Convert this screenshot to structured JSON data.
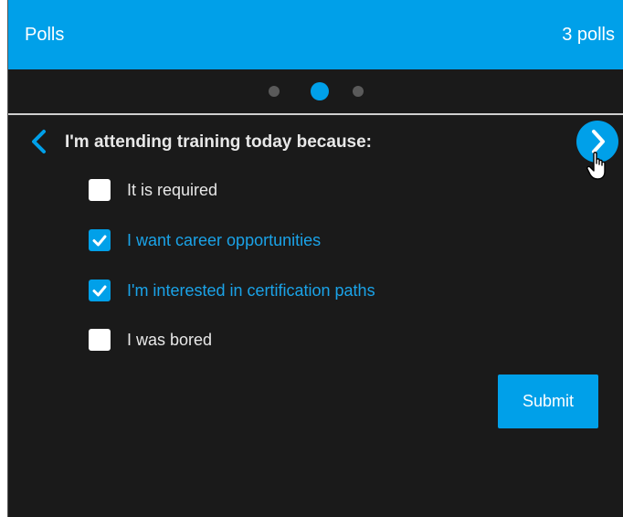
{
  "header": {
    "title": "Polls",
    "count": "3 polls"
  },
  "pager": {
    "total": 3,
    "active_index": 2
  },
  "poll": {
    "question": "I'm attending training today because:",
    "options": [
      {
        "label": "It is required",
        "checked": false
      },
      {
        "label": "I want career opportunities",
        "checked": true
      },
      {
        "label": "I'm interested in certification paths",
        "checked": true
      },
      {
        "label": "I was bored",
        "checked": false
      }
    ],
    "submit_label": "Submit"
  },
  "icons": {
    "back": "chevron-left-icon",
    "next": "chevron-right-icon",
    "cursor": "hand-pointer-icon",
    "check": "checkmark-icon"
  },
  "colors": {
    "accent": "#00a0e9",
    "background": "#1a1a1a",
    "text": "#e8e8e8",
    "selected_text": "#1aa3e8"
  }
}
